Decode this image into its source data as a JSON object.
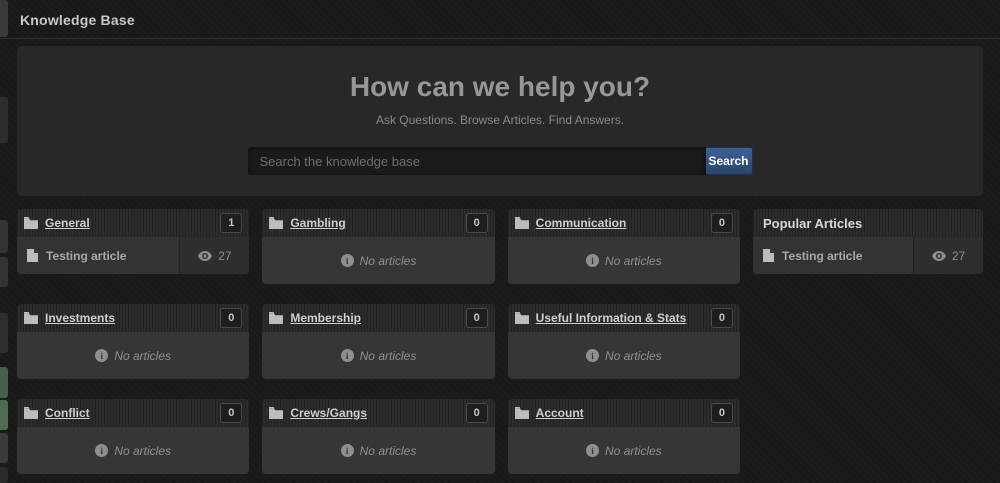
{
  "page": {
    "title": "Knowledge Base"
  },
  "hero": {
    "title": "How can we help you?",
    "subtitle": "Ask Questions. Browse Articles. Find Answers.",
    "search_placeholder": "Search the knowledge base",
    "search_button": "Search"
  },
  "categories": [
    {
      "name": "General",
      "count": "1",
      "articles": [
        {
          "title": "Testing article",
          "views": "27"
        }
      ]
    },
    {
      "name": "Gambling",
      "count": "0",
      "empty": "No articles"
    },
    {
      "name": "Communication",
      "count": "0",
      "empty": "No articles"
    },
    {
      "name": "Investments",
      "count": "0",
      "empty": "No articles"
    },
    {
      "name": "Membership",
      "count": "0",
      "empty": "No articles"
    },
    {
      "name": "Useful Information & Stats",
      "count": "0",
      "empty": "No articles"
    },
    {
      "name": "Conflict",
      "count": "0",
      "empty": "No articles"
    },
    {
      "name": "Crews/Gangs",
      "count": "0",
      "empty": "No articles"
    },
    {
      "name": "Account",
      "count": "0",
      "empty": "No articles"
    }
  ],
  "popular": {
    "title": "Popular Articles",
    "articles": [
      {
        "title": "Testing article",
        "views": "27"
      }
    ]
  },
  "colors": {
    "accent_button": "#3e6296",
    "fragment_green": "#4c6b50",
    "background": "#191919"
  }
}
